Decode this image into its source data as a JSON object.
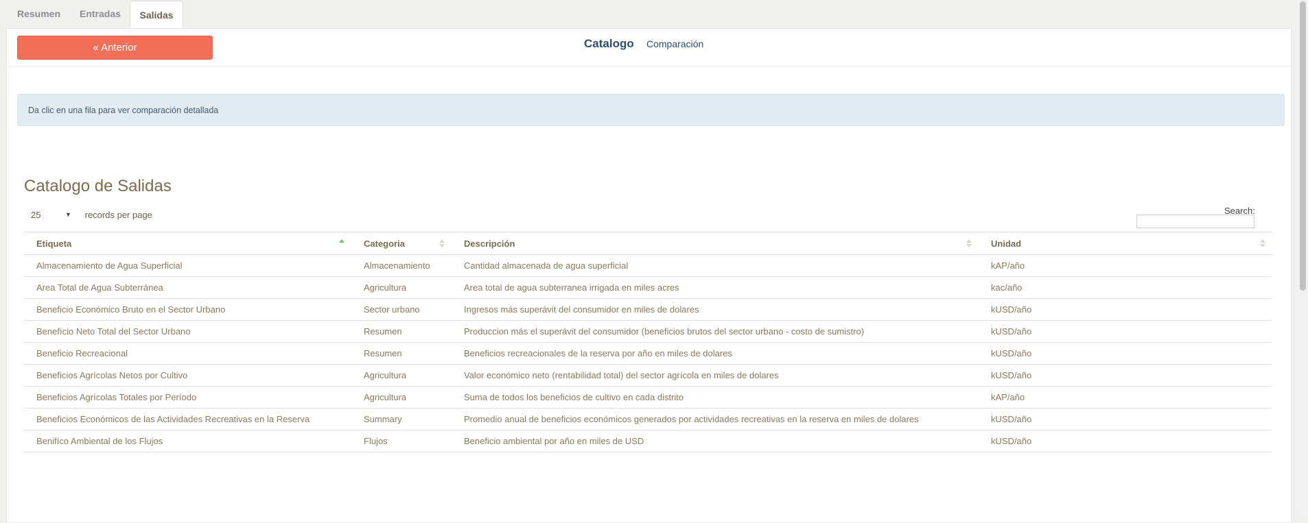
{
  "tabs": [
    {
      "label": "Resumen"
    },
    {
      "label": "Entradas"
    },
    {
      "label": "Salidas"
    }
  ],
  "toolbar": {
    "prev_label": "« Anterior",
    "nav_catalog": "Catalogo",
    "nav_compare": "Comparación"
  },
  "alert": {
    "text": "Da clic en una fila para ver comparación detallada"
  },
  "heading": "Catalogo de Salidas",
  "table_controls": {
    "page_size": "25",
    "page_size_label": "records per page",
    "search_label": "Search:",
    "search_value": ""
  },
  "table": {
    "columns": [
      "Etiqueta",
      "Categoria",
      "Descripción",
      "Unidad"
    ],
    "sorted_column": "Etiqueta",
    "sort_direction": "ascending",
    "rows": [
      [
        "Almacenamiento de Agua Superficial",
        "Almacenamiento",
        "Cantidad almacenada de agua superficial",
        "kAP/año"
      ],
      [
        "Area Total de Agua Subterránea",
        "Agricultura",
        "Area total de agua subterranea irrigada en miles acres",
        "kac/año"
      ],
      [
        "Beneficio Económico Bruto en el Sector Urbano",
        "Sector urbano",
        "Ingresos más superávit del consumidor en miles de dolares",
        "kUSD/año"
      ],
      [
        "Benefício Neto Total del Sector Urbano",
        "Resumen",
        "Produccion más el superávit del consumidor (beneficios brutos del sector urbano - costo de sumistro)",
        "kUSD/año"
      ],
      [
        "Beneficio Recreacional",
        "Resumen",
        "Beneficios recreacionales de la reserva por año en miles de dolares",
        "kUSD/año"
      ],
      [
        "Beneficios Agrícolas Netos por Cultivo",
        "Agricultura",
        "Valor económico neto (rentabilidad total) del sector agrícola en miles de dolares",
        "kUSD/año"
      ],
      [
        "Beneficios Agrícolas Totales por Período",
        "Agricultura",
        "Suma de todos los beneficios de cultivo en cada distrito",
        "kAP/año"
      ],
      [
        "Beneficios Económicos de las Actividades Recreativas en la Reserva",
        "Summary",
        "Promedio anual de beneficios económicos generados por actividades recreativas en la reserva en miles de dolares",
        "kUSD/año"
      ],
      [
        "Benifíco Ambiental de los Flujos",
        "Flujos",
        "Beneficio ambiental por año en miles de USD",
        "kUSD/año"
      ]
    ]
  }
}
